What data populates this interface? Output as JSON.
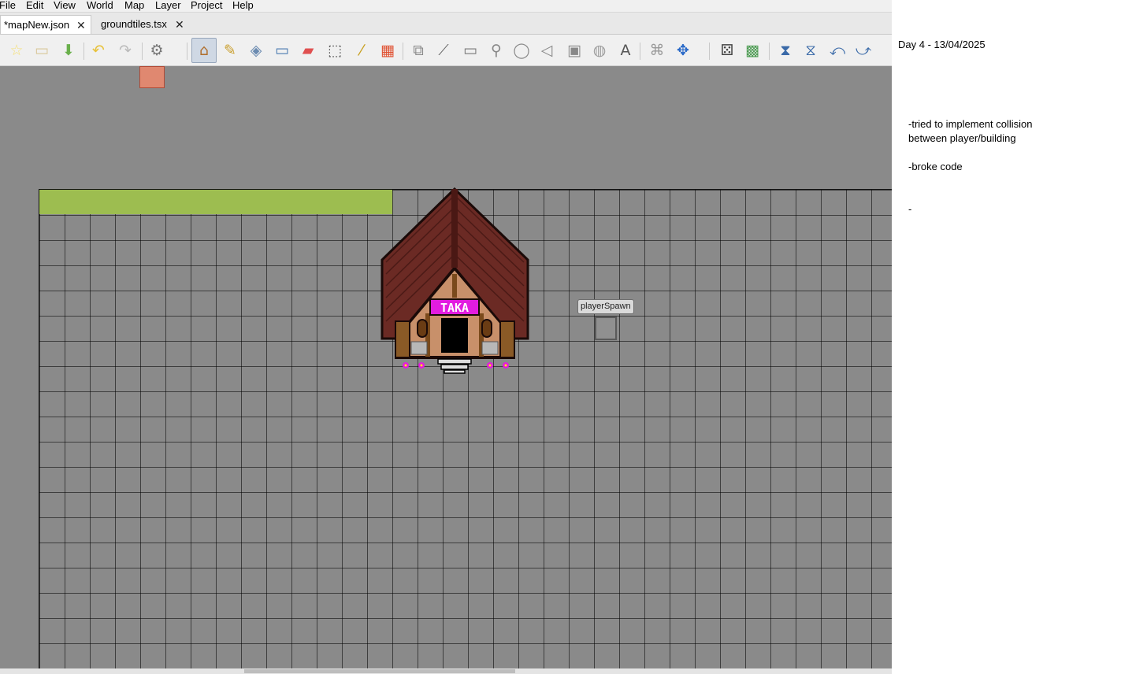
{
  "menu": {
    "items": [
      "File",
      "Edit",
      "View",
      "World",
      "Map",
      "Layer",
      "Project",
      "Help"
    ]
  },
  "tabs": [
    {
      "label": "*mapNew.json",
      "active": true
    },
    {
      "label": "groundtiles.tsx",
      "active": false
    }
  ],
  "toolbar": {
    "icons": [
      "new-map-icon",
      "open-file-icon",
      "save-icon",
      "undo-icon",
      "redo-icon",
      "commands-icon",
      "stamp-brush-icon",
      "terrain-brush-icon",
      "bucket-fill-icon",
      "shape-fill-icon",
      "eraser-icon",
      "rectangular-select-icon",
      "magic-wand-icon",
      "select-same-tile-icon",
      "select-objects-icon",
      "edit-polygons-icon",
      "insert-rectangle-icon",
      "insert-point-icon",
      "insert-ellipse-icon",
      "insert-polygon-icon",
      "insert-tile-icon",
      "insert-template-icon",
      "insert-text-icon",
      "layer-offset-icon",
      "move-icon",
      "random-mode-icon",
      "wang-fill-icon",
      "flip-horizontal-icon",
      "flip-vertical-icon",
      "rotate-left-icon",
      "rotate-right-icon"
    ],
    "active_tool": "stamp-brush-icon"
  },
  "map": {
    "object_label": "playerSpawn",
    "building_sign": "TAKA",
    "colors": {
      "canvas": "#8a8a8a",
      "grass": "#9dbd50",
      "red_tile": "#e08870",
      "roof": "#6b2a24",
      "wall": "#c8906a",
      "beam": "#7a4a1c",
      "sign": "#e21ce0"
    }
  },
  "notes": {
    "title": "Day 4 - 13/04/2025",
    "line1": "-tried to implement collision",
    "line2": "between player/building",
    "line3": "-broke code",
    "line4": "-"
  }
}
